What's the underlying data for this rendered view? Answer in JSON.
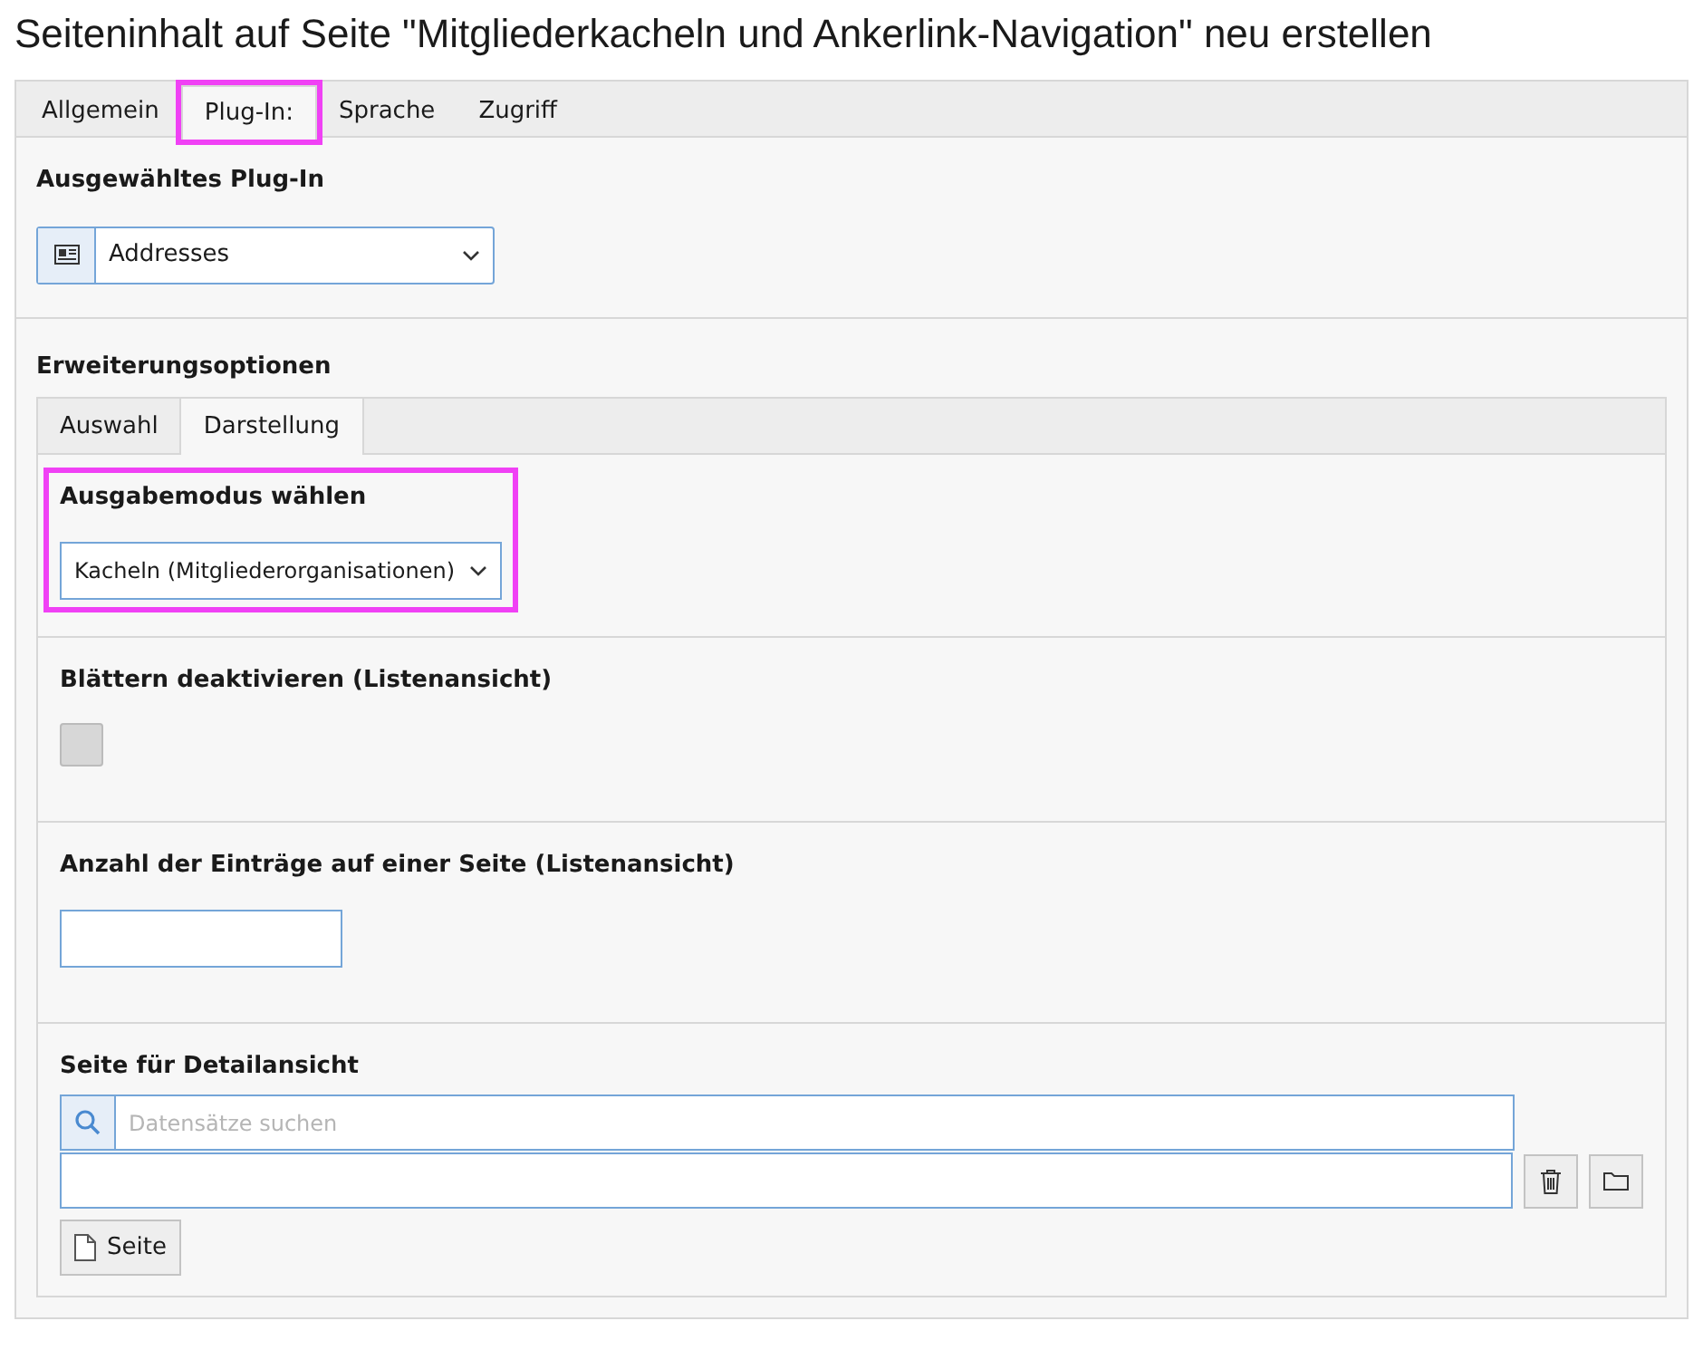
{
  "window": {
    "title": "Seiteninhalt auf Seite \"Mitgliederkacheln und Ankerlink-Navigation\" neu erstellen"
  },
  "tabs": [
    {
      "label": "Allgemein",
      "selected": false,
      "highlighted": false
    },
    {
      "label": "Plug-In:",
      "selected": true,
      "highlighted": true
    },
    {
      "label": "Sprache",
      "selected": false,
      "highlighted": false
    },
    {
      "label": "Zugriff",
      "selected": false,
      "highlighted": false
    }
  ],
  "plugin": {
    "label": "Ausgewähltes Plug-In",
    "value": "Addresses"
  },
  "extension": {
    "label": "Erweiterungsoptionen",
    "tabs": [
      {
        "label": "Auswahl",
        "selected": false
      },
      {
        "label": "Darstellung",
        "selected": true
      }
    ],
    "fields": [
      {
        "kind": "select",
        "label": "Ausgabemodus wählen",
        "value": "Kacheln (Mitgliederorganisationen)",
        "highlighted": true
      },
      {
        "kind": "checkbox",
        "label": "Blättern deaktivieren (Listenansicht)",
        "checked": false,
        "highlighted": false
      },
      {
        "kind": "text",
        "label": "Anzahl der Einträge auf einer Seite (Listenansicht)",
        "highlighted": false
      },
      {
        "kind": "relation",
        "label": "Seite für Detailansicht",
        "placeholder": "Datensätze suchen",
        "button": "Seite",
        "highlighted": false
      }
    ]
  }
}
